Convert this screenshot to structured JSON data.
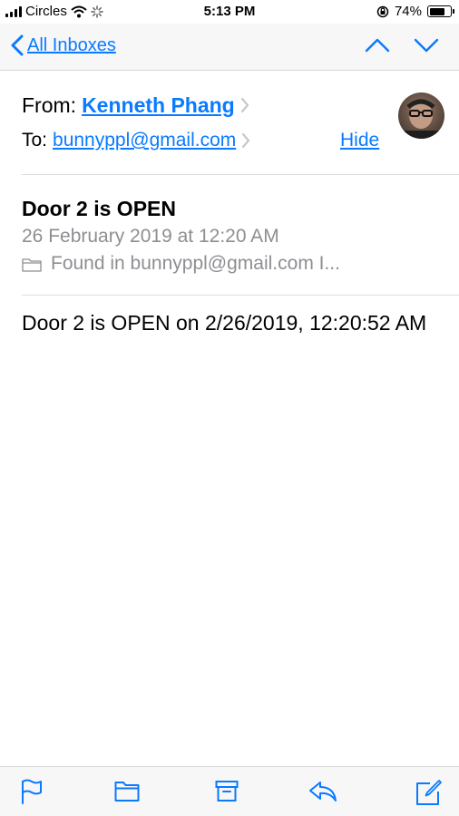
{
  "status_bar": {
    "carrier": "Circles",
    "time": "5:13 PM",
    "battery_percent": "74%",
    "battery_level": 0.74
  },
  "nav": {
    "back_label": "All Inboxes",
    "icons": [
      "chevron-left-icon",
      "chevron-up-icon",
      "chevron-down-icon"
    ]
  },
  "header": {
    "from_label": "From:",
    "from_name": "Kenneth Phang",
    "to_label": "To:",
    "to_address": "bunnyppl@gmail.com",
    "hide_label": "Hide"
  },
  "message": {
    "subject": "Door 2 is OPEN",
    "date": "26 February 2019 at 12:20 AM",
    "found_in": "Found in bunnyppl@gmail.com I...",
    "body": "Door 2 is OPEN on 2/26/2019, 12:20:52 AM"
  },
  "toolbar": {
    "icons": [
      "flag-icon",
      "folder-icon",
      "archive-icon",
      "reply-icon",
      "compose-icon"
    ]
  },
  "colors": {
    "accent": "#0a7aff",
    "secondary_text": "#8e8e93",
    "bar_background": "#f7f7f7"
  }
}
